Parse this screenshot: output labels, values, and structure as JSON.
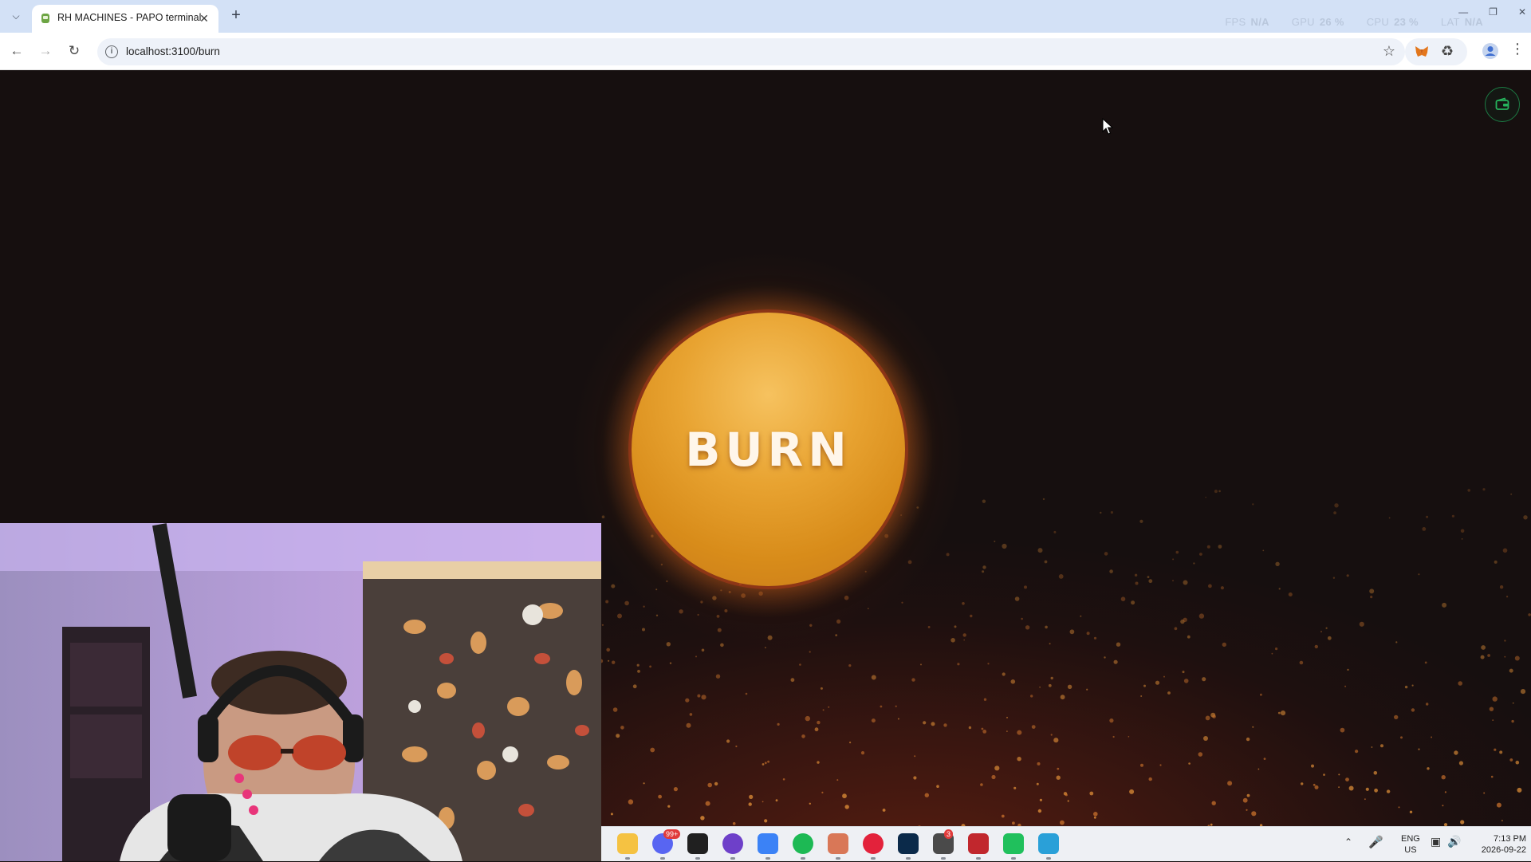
{
  "browser": {
    "tab_title": "RH MACHINES - PAPO terminal",
    "url": "localhost:3100/burn"
  },
  "overlay": {
    "fps_label": "FPS",
    "fps_value": "N/A",
    "gpu_label": "GPU",
    "gpu_value": "26 %",
    "cpu_label": "CPU",
    "cpu_value": "23 %",
    "lat_label": "LAT",
    "lat_value": "N/A"
  },
  "page": {
    "burn_label": "BURN"
  },
  "taskbar": {
    "apps": [
      "file-explorer-icon",
      "discord-icon",
      "roblox-icon",
      "github-icon",
      "app-icon",
      "spotify-icon",
      "claude-icon",
      "opera-icon",
      "photoshop-icon",
      "openai-icon",
      "app-red-icon",
      "app-green-icon",
      "notepad-icon"
    ],
    "discord_badge": "99+",
    "openai_badge": "3",
    "lang_top": "ENG",
    "lang_bottom": "US",
    "time": "7:13 PM",
    "date": "2026-09-22"
  },
  "colors": {
    "background": "#160f0f",
    "burn_orb": "#e8a331",
    "accent_green": "#1c7a43",
    "tabstrip": "#d3e1f6"
  }
}
